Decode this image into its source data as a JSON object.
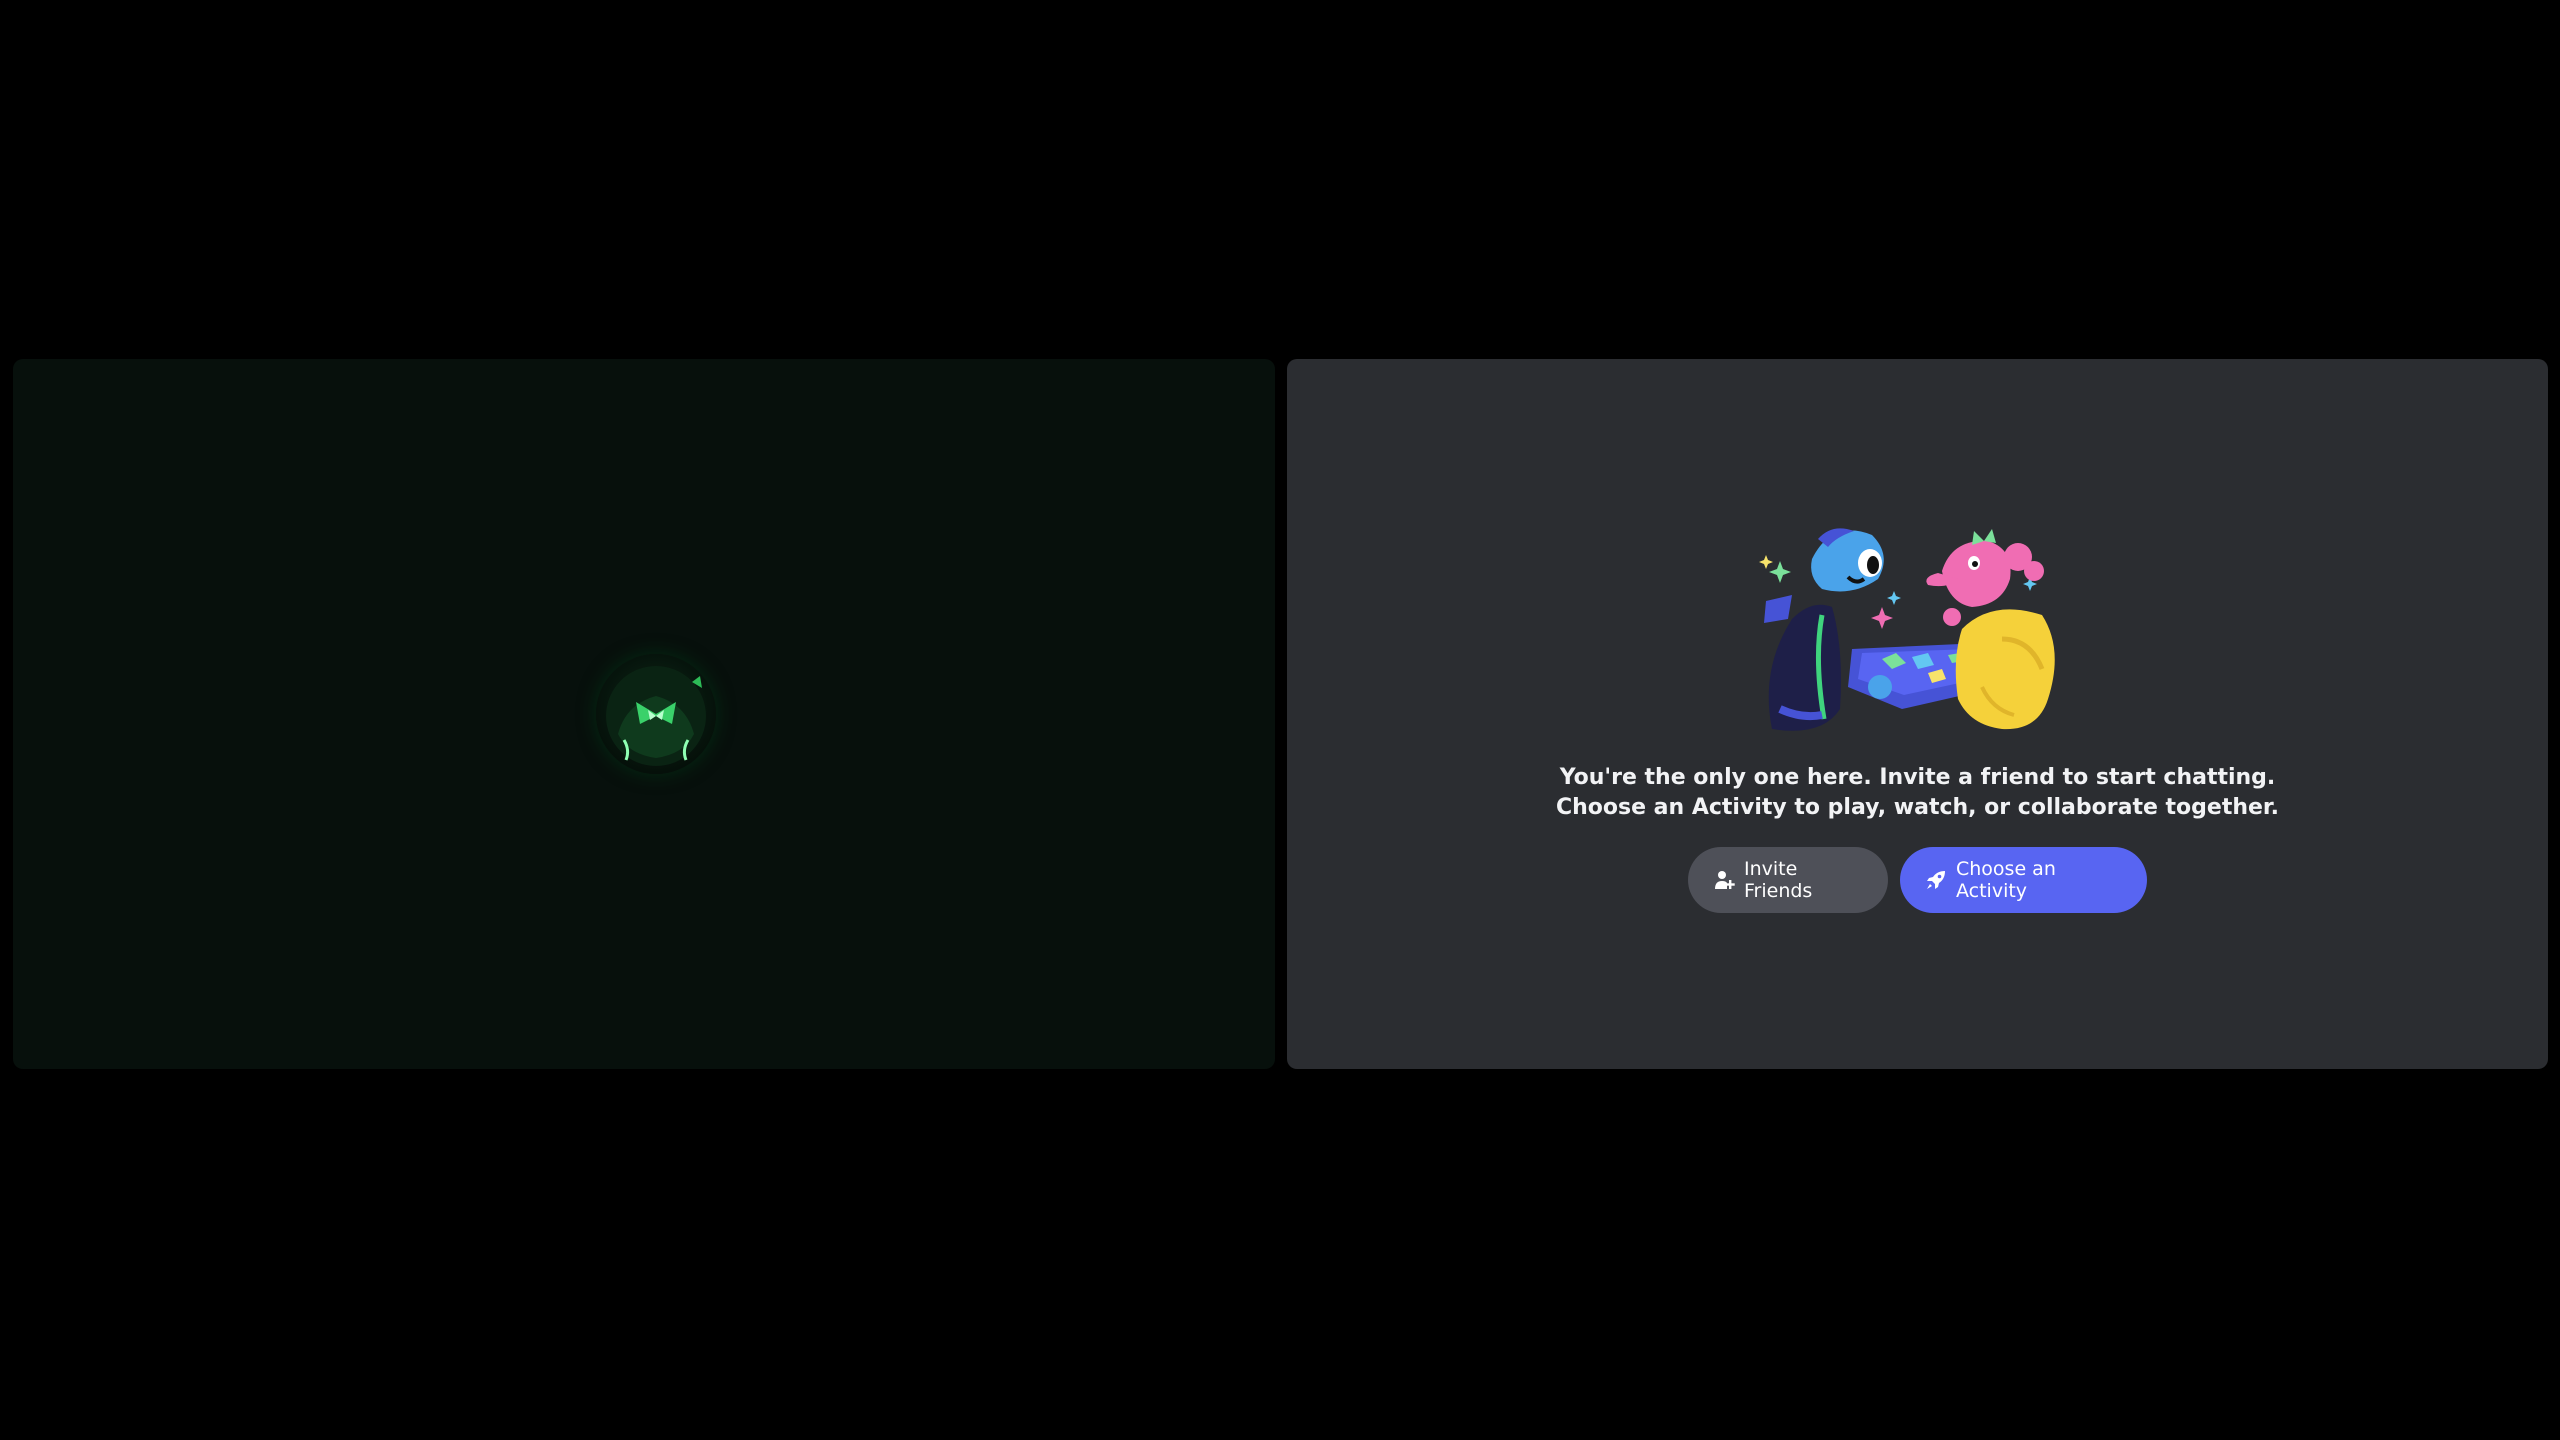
{
  "call": {
    "participant_tile": {
      "avatar": "avatar-icon"
    },
    "empty_state": {
      "message_line1": "You're the only one here. Invite a friend to start chatting.",
      "message_line2": "Choose an Activity to play, watch, or collaborate together.",
      "invite_button": {
        "label": "Invite Friends",
        "icon": "add-friend-icon"
      },
      "activity_button": {
        "label": "Choose an Activity",
        "icon": "rocket-icon"
      }
    }
  },
  "colors": {
    "background": "#000000",
    "tile_left": "#07100c",
    "tile_right": "#2b2d31",
    "invite_button": "#4e5058",
    "activity_button": "#5865f2",
    "text": "#f2f3f5"
  }
}
